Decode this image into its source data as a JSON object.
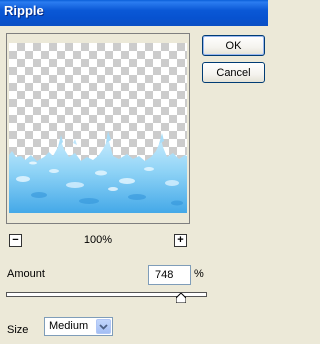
{
  "window": {
    "title": "Ripple"
  },
  "buttons": {
    "ok": "OK",
    "cancel": "Cancel"
  },
  "preview": {
    "zoom_out_symbol": "−",
    "zoom_in_symbol": "+",
    "zoom_level": "100%"
  },
  "amount": {
    "label": "Amount",
    "value": "748",
    "unit": "%",
    "slider_fraction": 0.87
  },
  "size": {
    "label": "Size",
    "selected": "Medium"
  },
  "colors": {
    "title_bar": "#0a58d6",
    "dialog_bg": "#ece9d8",
    "water_light": "#bfe6fb",
    "water_mid": "#7cc9f2",
    "water_dark": "#3ca4e6"
  }
}
